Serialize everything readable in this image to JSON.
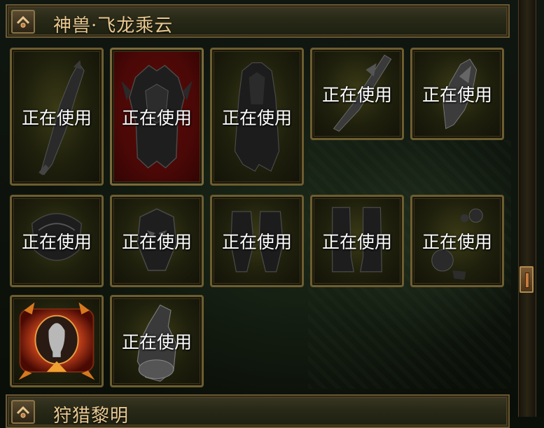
{
  "sections": [
    {
      "title": "神兽·飞龙乘云"
    },
    {
      "title": "狩猎黎明"
    }
  ],
  "slots": [
    {
      "item": "dragon-sword-icon",
      "status": "正在使用"
    },
    {
      "item": "dragon-armor-icon",
      "status": "正在使用"
    },
    {
      "item": "dragon-robe-icon",
      "status": "正在使用"
    },
    {
      "item": "dragon-blade-icon",
      "status": "正在使用"
    },
    {
      "item": "dragon-wing-icon",
      "status": "正在使用"
    },
    {
      "item": "dragon-helm-icon",
      "status": "正在使用"
    },
    {
      "item": "dragon-mask-icon",
      "status": "正在使用"
    },
    {
      "item": "dragon-bracers-icon",
      "status": "正在使用"
    },
    {
      "item": "dragon-boots-icon",
      "status": "正在使用"
    },
    {
      "item": "dragon-ornaments-icon",
      "status": "正在使用"
    },
    {
      "item": "avatar-frame-icon",
      "status": ""
    },
    {
      "item": "dragon-statue-icon",
      "status": "正在使用"
    }
  ],
  "colors": {
    "selected_slot": "#4a0806",
    "slot_border": "#6c5d30",
    "title_text": "#e8c890"
  }
}
